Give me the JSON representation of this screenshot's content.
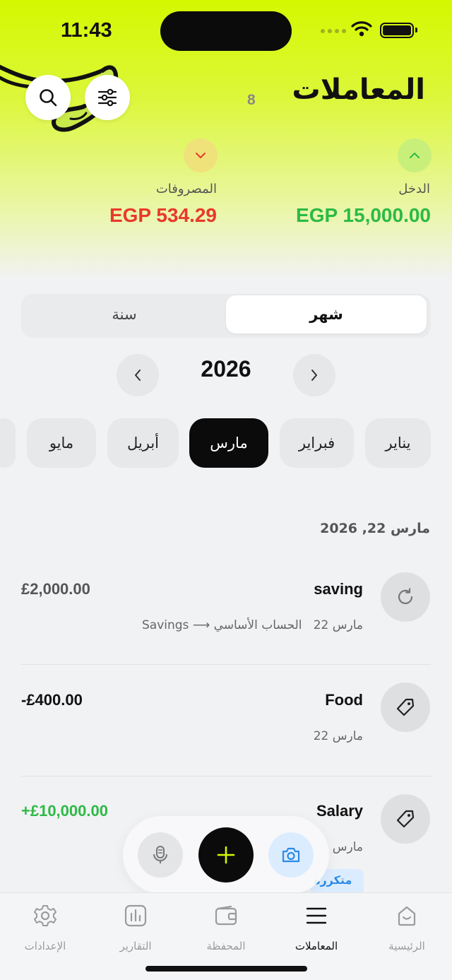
{
  "status": {
    "time": "11:43"
  },
  "header": {
    "title": "المعاملات",
    "count": "8"
  },
  "summary": {
    "income": {
      "label": "الدخل",
      "value": "EGP 15,000.00",
      "color": "#2cba45"
    },
    "expenses": {
      "label": "المصروفات",
      "value": "EGP 534.29",
      "color": "#e8392b"
    }
  },
  "segment": {
    "month": "شهر",
    "year": "سنة",
    "selected": "month"
  },
  "year": "2026",
  "months": [
    "يناير",
    "فبراير",
    "مارس",
    "أبريل",
    "مايو"
  ],
  "selected_month": "مارس",
  "date_header": "مارس 22, 2026",
  "transactions": [
    {
      "name": "saving",
      "date": "مارس 22",
      "account": "الحساب الأساسي",
      "arrow": "⟶",
      "target": "Savings",
      "amount": "£2,000.00",
      "icon": "refresh-icon",
      "amount_color": "#555555"
    },
    {
      "name": "Food",
      "date": "مارس 22",
      "amount": "-£400.00",
      "icon": "tag-icon",
      "amount_color": "#111111"
    },
    {
      "name": "Salary",
      "date": "مارس",
      "amount": "+£10,000.00",
      "icon": "tag-icon",
      "amount_color": "#2cba45",
      "tag": "متكررة"
    }
  ],
  "tabs": [
    {
      "label": "الرئيسية",
      "icon": "home-icon"
    },
    {
      "label": "المعاملات",
      "icon": "list-icon",
      "active": true
    },
    {
      "label": "المحفظة",
      "icon": "wallet-icon"
    },
    {
      "label": "التقارير",
      "icon": "chart-icon"
    },
    {
      "label": "الإعدادات",
      "icon": "gear-icon"
    }
  ],
  "colors": {
    "accent": "#d4f800",
    "dark": "#0b0b0b",
    "blue": "#2b8be6"
  }
}
